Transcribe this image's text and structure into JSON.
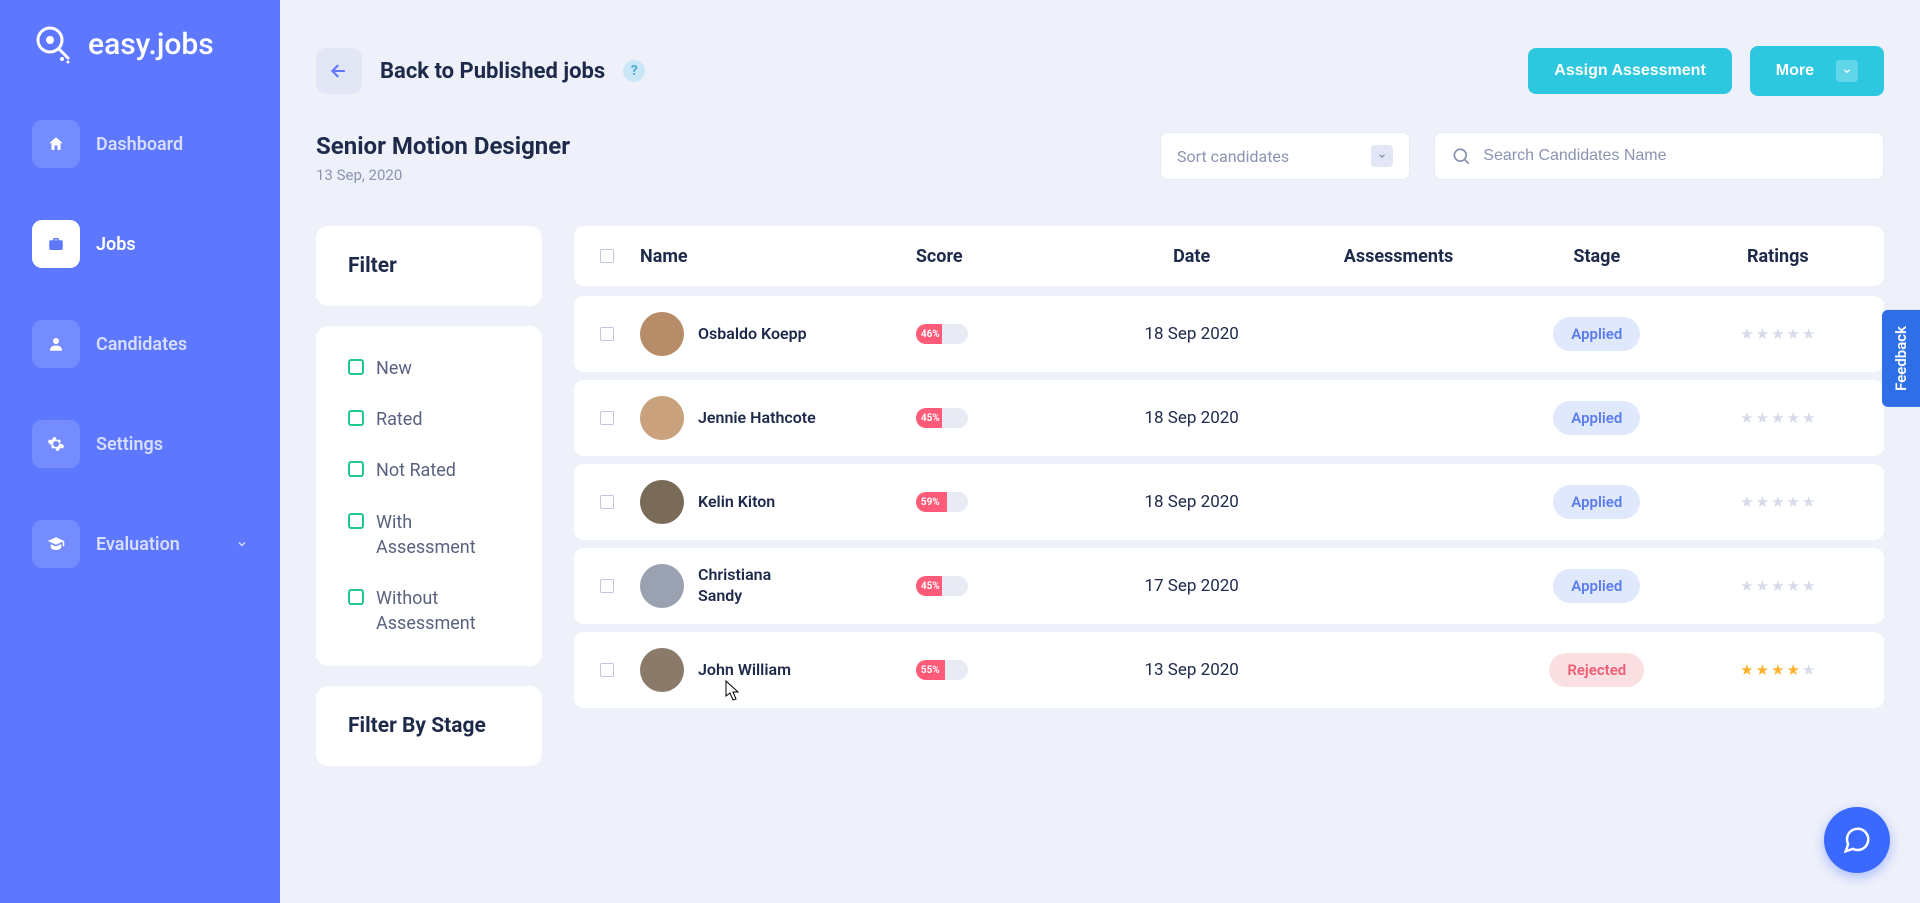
{
  "brand": "easy.jobs",
  "nav": {
    "dashboard": "Dashboard",
    "jobs": "Jobs",
    "candidates": "Candidates",
    "settings": "Settings",
    "evaluation": "Evaluation"
  },
  "header": {
    "back": "Back to Published jobs",
    "assign": "Assign Assessment",
    "more": "More"
  },
  "job": {
    "title": "Senior Motion Designer",
    "date": "13 Sep, 2020"
  },
  "controls": {
    "sort": "Sort candidates",
    "search_placeholder": "Search Candidates Name"
  },
  "filter": {
    "title": "Filter",
    "opts": {
      "new": "New",
      "rated": "Rated",
      "not_rated": "Not Rated",
      "with": "With Assessment",
      "without": "Without Assessment"
    },
    "by_stage": "Filter By Stage"
  },
  "table": {
    "headers": {
      "name": "Name",
      "score": "Score",
      "date": "Date",
      "assessments": "Assessments",
      "stage": "Stage",
      "ratings": "Ratings"
    },
    "rows": [
      {
        "name": "Osbaldo Koepp",
        "score": "46%",
        "scorew": 50,
        "date": "18 Sep 2020",
        "stage": "Applied",
        "stage_cls": "stage-applied",
        "rating": 0,
        "av": "#b78c68"
      },
      {
        "name": "Jennie Hathcote",
        "score": "45%",
        "scorew": 50,
        "date": "18 Sep 2020",
        "stage": "Applied",
        "stage_cls": "stage-applied",
        "rating": 0,
        "av": "#c9a27d"
      },
      {
        "name": "Kelin Kiton",
        "score": "59%",
        "scorew": 60,
        "date": "18 Sep 2020",
        "stage": "Applied",
        "stage_cls": "stage-applied",
        "rating": 0,
        "av": "#7a6b58"
      },
      {
        "name": "Christiana Sandy",
        "score": "45%",
        "scorew": 50,
        "date": "17 Sep 2020",
        "stage": "Applied",
        "stage_cls": "stage-applied",
        "rating": 0,
        "av": "#9aa1b0"
      },
      {
        "name": "John William",
        "score": "55%",
        "scorew": 56,
        "date": "13 Sep 2020",
        "stage": "Rejected",
        "stage_cls": "stage-rejected",
        "rating": 4,
        "av": "#8b7a6a"
      }
    ]
  },
  "feedback": "Feedback"
}
